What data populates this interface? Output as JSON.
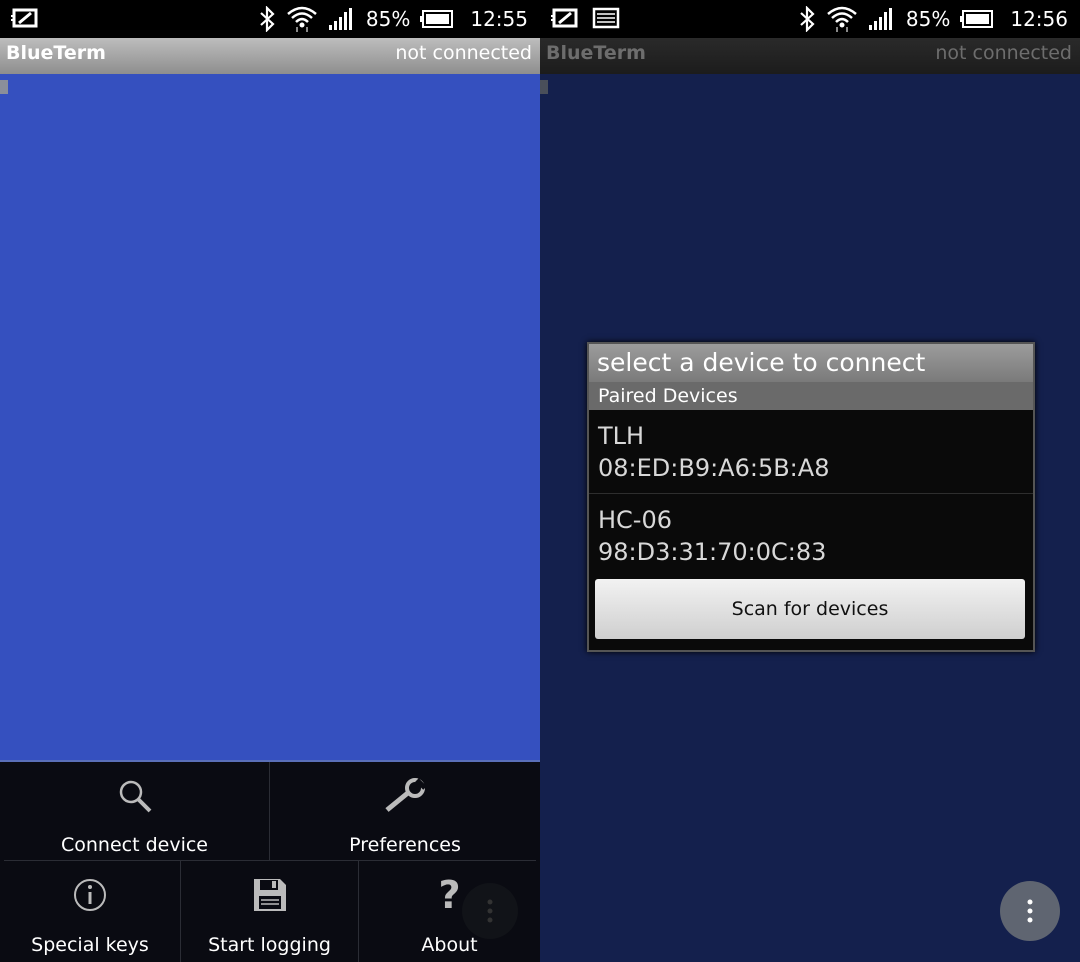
{
  "left": {
    "status": {
      "battery": "85%",
      "time": "12:55"
    },
    "titlebar": {
      "app_title": "BlueTerm",
      "connection": "not connected"
    },
    "menu": {
      "items": [
        {
          "label": "Connect device",
          "icon": "search-icon"
        },
        {
          "label": "Preferences",
          "icon": "wrench-icon"
        },
        {
          "label": "Special keys",
          "icon": "info-icon"
        },
        {
          "label": "Start logging",
          "icon": "save-icon"
        },
        {
          "label": "About",
          "icon": "question-icon"
        }
      ]
    }
  },
  "right": {
    "status": {
      "battery": "85%",
      "time": "12:56"
    },
    "titlebar": {
      "app_title": "BlueTerm",
      "connection": "not connected"
    },
    "dialog": {
      "title": "select a device to connect",
      "section": "Paired Devices",
      "devices": [
        {
          "name": "TLH",
          "address": "08:ED:B9:A6:5B:A8"
        },
        {
          "name": "HC-06",
          "address": "98:D3:31:70:0C:83"
        }
      ],
      "scan_button": "Scan for devices"
    }
  },
  "colors": {
    "terminal_bg": "#3550bf",
    "terminal_dimmed": "#14204d",
    "menu_bg": "#0a0b12"
  }
}
